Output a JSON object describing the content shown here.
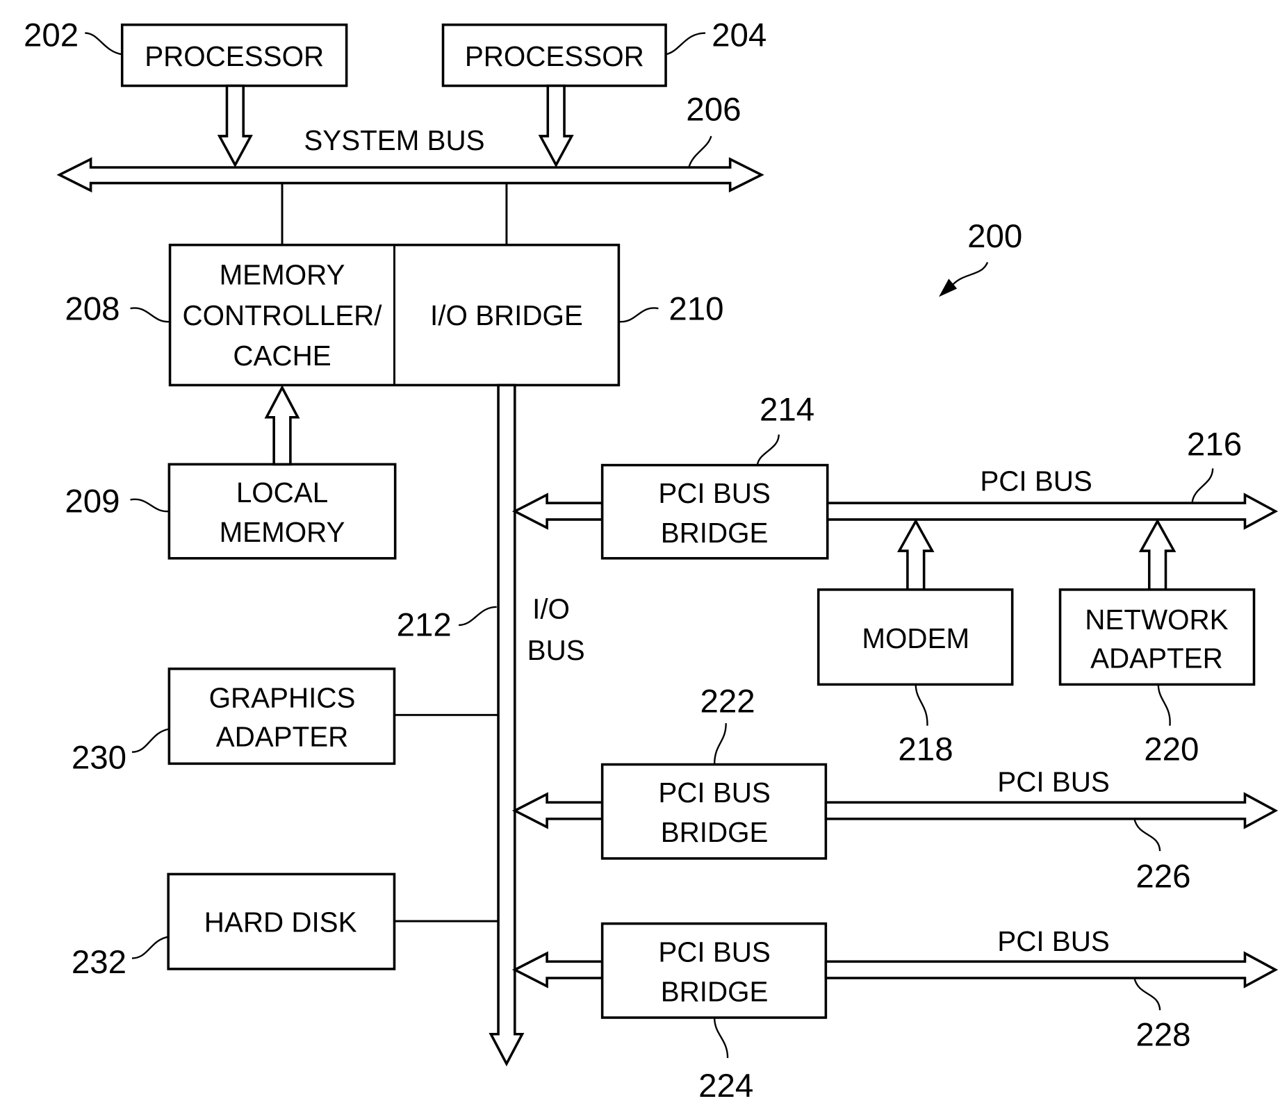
{
  "figure": {
    "reference": "200",
    "components": {
      "processor_1": {
        "label": [
          "PROCESSOR"
        ],
        "ref": "202"
      },
      "processor_2": {
        "label": [
          "PROCESSOR"
        ],
        "ref": "204"
      },
      "memory_controller": {
        "label": [
          "MEMORY",
          "CONTROLLER/",
          "CACHE"
        ],
        "ref": "208"
      },
      "io_bridge": {
        "label": [
          "I/O BRIDGE"
        ],
        "ref": "210"
      },
      "local_memory": {
        "label": [
          "LOCAL",
          "MEMORY"
        ],
        "ref": "209"
      },
      "graphics_adapter": {
        "label": [
          "GRAPHICS",
          "ADAPTER"
        ],
        "ref": "230"
      },
      "hard_disk": {
        "label": [
          "HARD DISK"
        ],
        "ref": "232"
      },
      "pci_bridge_1": {
        "label": [
          "PCI BUS",
          "BRIDGE"
        ],
        "ref": "214"
      },
      "pci_bridge_2": {
        "label": [
          "PCI BUS",
          "BRIDGE"
        ],
        "ref": "222"
      },
      "pci_bridge_3": {
        "label": [
          "PCI BUS",
          "BRIDGE"
        ],
        "ref": "224"
      },
      "modem": {
        "label": [
          "MODEM"
        ],
        "ref": "218"
      },
      "network_adapter": {
        "label": [
          "NETWORK",
          "ADAPTER"
        ],
        "ref": "220"
      }
    },
    "buses": {
      "system_bus": {
        "label": "SYSTEM BUS",
        "ref": "206"
      },
      "io_bus": {
        "label": [
          "I/O",
          "BUS"
        ],
        "ref": "212"
      },
      "pci_bus_1": {
        "label": "PCI BUS",
        "ref": "216"
      },
      "pci_bus_2": {
        "label": "PCI BUS",
        "ref": "226"
      },
      "pci_bus_3": {
        "label": "PCI BUS",
        "ref": "228"
      }
    }
  }
}
